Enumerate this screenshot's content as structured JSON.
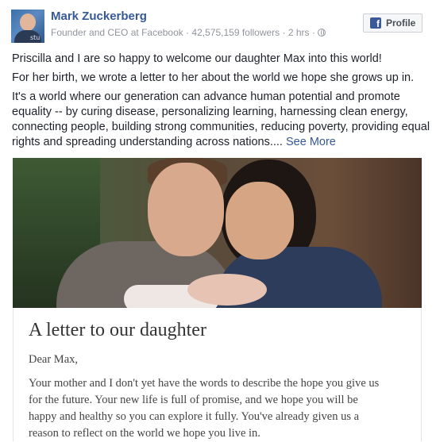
{
  "author": {
    "name": "Mark Zuckerberg",
    "meta": "Founder and CEO at Facebook · 42,575,159 followers · 2 hrs ·",
    "avatar_text": "stu"
  },
  "profile_button": {
    "icon": "f",
    "label": "Profile"
  },
  "post": {
    "para1": "Priscilla and I are so happy to welcome our daughter Max into this world!",
    "para2": "For her birth, we wrote a letter to her about the world we hope she grows up in.",
    "para3_lines": [
      "It's a world where our generation can advance human potential and promote",
      "equality -- by curing disease, personalizing learning, harnessing clean energy,",
      "connecting people, building strong communities, reducing poverty, providing equal",
      "rights and spreading understanding across nations...."
    ],
    "see_more": "See More"
  },
  "letter": {
    "title": "A letter to our daughter",
    "salutation": "Dear Max,",
    "body_lines": [
      "Your mother and I don't yet have the words to describe the hope you give us",
      "for the future. Your new life is full of promise, and we hope you will be",
      "happy and healthy so you can explore it fully. You've already given us a",
      "reason to reflect on the world we hope you live in."
    ]
  },
  "colors": {
    "link": "#365899",
    "meta": "#90949c",
    "fb_blue": "#3b5998"
  }
}
